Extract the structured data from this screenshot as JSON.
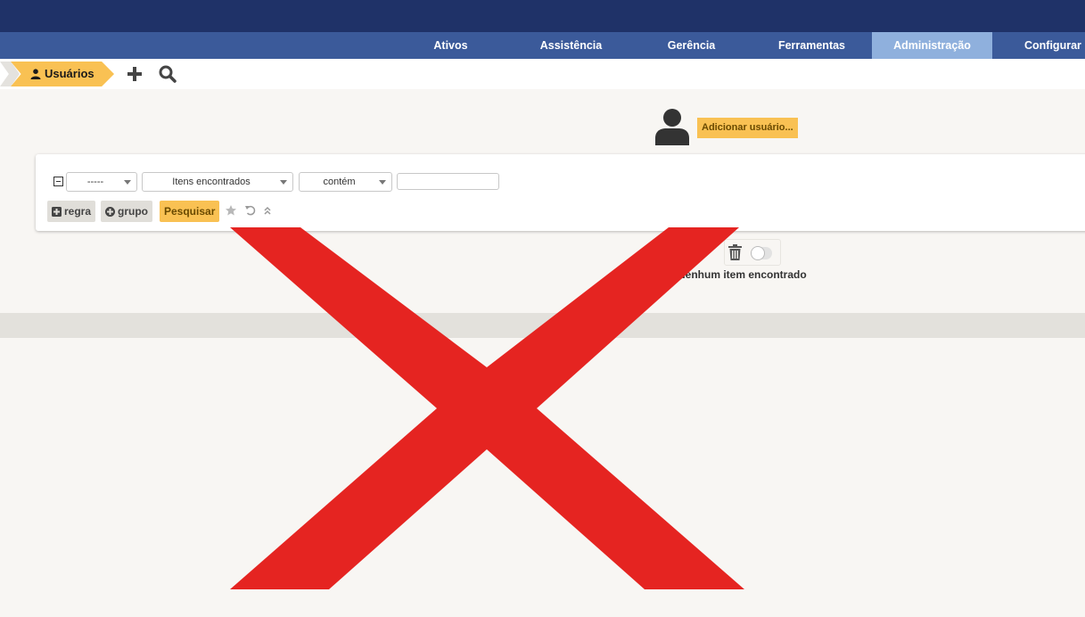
{
  "menu": {
    "items": [
      {
        "label": "Ativos"
      },
      {
        "label": "Assistência"
      },
      {
        "label": "Gerência"
      },
      {
        "label": "Ferramentas"
      },
      {
        "label": "Administração",
        "active": true
      },
      {
        "label": "Configurar"
      }
    ]
  },
  "breadcrumb": {
    "label": "Usuários",
    "icon": "user-icon",
    "actions": [
      "plus-icon",
      "search-icon"
    ]
  },
  "add_user": {
    "icon": "user-silhouette-icon",
    "button_label": "Adicionar usuário..."
  },
  "search": {
    "field_select": "-----",
    "criteria_select": "Itens encontrados",
    "operator_select": "contém",
    "value_input": "",
    "rule_button": "regra",
    "group_button": "grupo",
    "search_button": "Pesquisar",
    "icons": [
      "star-icon",
      "reset-icon",
      "collapse-up-icon"
    ]
  },
  "results": {
    "status_text": "Nenhum item encontrado",
    "icons": [
      "trash-icon",
      "toggle-switch"
    ]
  },
  "colors": {
    "topbar": "#1f3268",
    "menubar": "#3b5a9a",
    "menu_active": "#8fb0dd",
    "accent": "#f9c153",
    "overlay_x": "#e52421"
  },
  "overlay": {
    "icon": "red-x-overlay"
  }
}
